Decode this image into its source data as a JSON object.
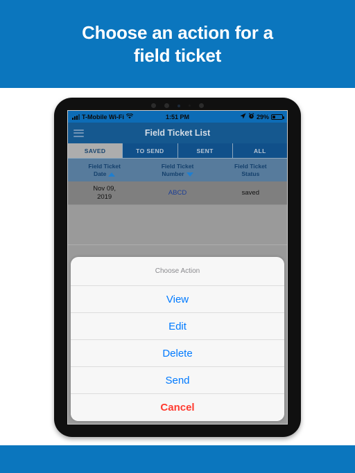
{
  "promo": {
    "title_line1": "Choose an action for a",
    "title_line2": "field ticket",
    "background": "#0b76be"
  },
  "device": {
    "status_bar": {
      "carrier": "T-Mobile Wi-Fi",
      "wifi_icon": "wifi-icon",
      "time": "1:51 PM",
      "location_icon": "location-arrow-icon",
      "alarm_icon": "alarm-clock-icon",
      "battery_percent": "29%",
      "battery_icon": "battery-icon"
    },
    "navbar": {
      "menu_icon": "hamburger-menu-icon",
      "title": "Field Ticket List",
      "background": "#15588f"
    },
    "tabs": [
      {
        "label": "SAVED",
        "active": true
      },
      {
        "label": "TO SEND",
        "active": false
      },
      {
        "label": "SENT",
        "active": false
      },
      {
        "label": "ALL",
        "active": false
      }
    ],
    "table": {
      "columns": [
        {
          "label_line1": "Field Ticket",
          "label_line2": "Date",
          "sort": "asc",
          "sort_icon": "caret-up-icon"
        },
        {
          "label_line1": "Field Ticket",
          "label_line2": "Number",
          "sort": "desc",
          "sort_icon": "caret-down-icon"
        },
        {
          "label_line1": "Field Ticket",
          "label_line2": "Status",
          "sort": "none",
          "sort_icon": ""
        }
      ],
      "rows": [
        {
          "date_line1": "Nov 09,",
          "date_line2": "2019",
          "number": "ABCD",
          "status": "saved"
        }
      ]
    },
    "action_sheet": {
      "title": "Choose Action",
      "items": [
        {
          "label": "View",
          "style": "default"
        },
        {
          "label": "Edit",
          "style": "default"
        },
        {
          "label": "Delete",
          "style": "default"
        },
        {
          "label": "Send",
          "style": "default"
        },
        {
          "label": "Cancel",
          "style": "destructive"
        }
      ],
      "accent_color": "#007aff",
      "destructive_color": "#ff3b30"
    }
  }
}
